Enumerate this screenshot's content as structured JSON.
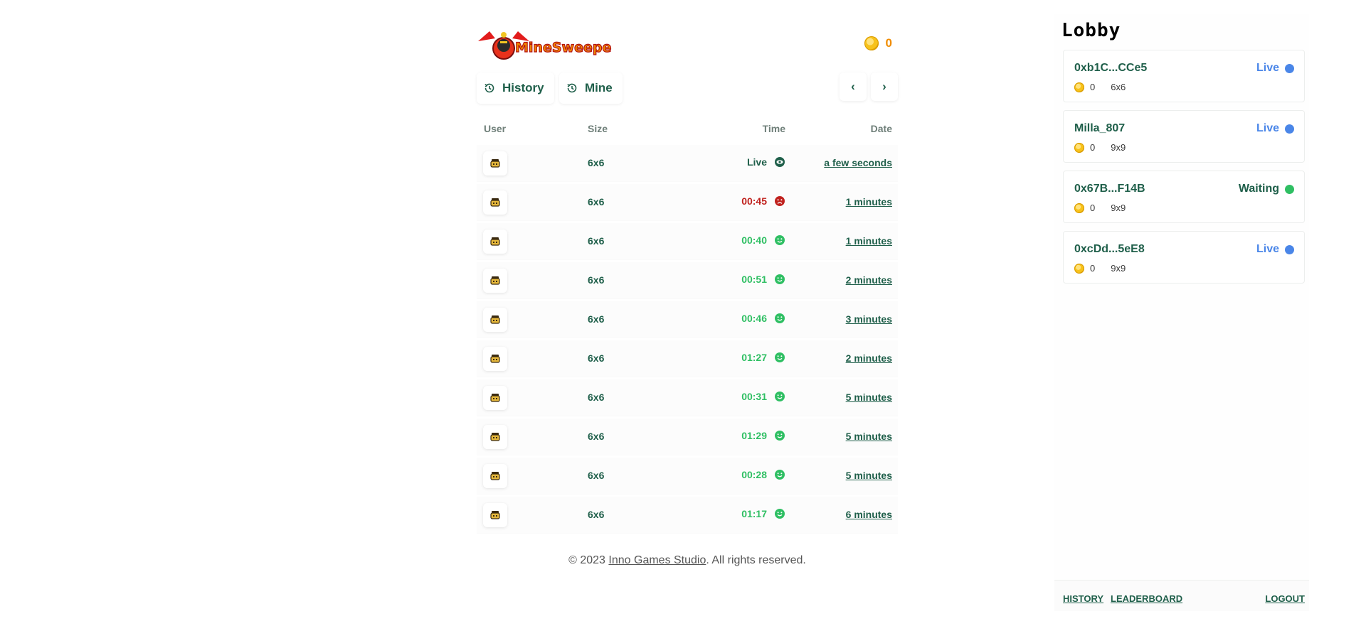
{
  "header": {
    "logo_text": "MineSweeper",
    "coin_balance": "0"
  },
  "tabs": [
    {
      "label": "History",
      "icon": "history-icon"
    },
    {
      "label": "Mine",
      "icon": "history-icon"
    }
  ],
  "pager": {
    "prev": "‹",
    "next": "›"
  },
  "table": {
    "columns": [
      "User",
      "Size",
      "Time",
      "Date"
    ],
    "rows": [
      {
        "size": "6x6",
        "time": "Live",
        "status": "live",
        "date": "a few seconds"
      },
      {
        "size": "6x6",
        "time": "00:45",
        "status": "lost",
        "date": "1 minutes"
      },
      {
        "size": "6x6",
        "time": "00:40",
        "status": "won",
        "date": "1 minutes"
      },
      {
        "size": "6x6",
        "time": "00:51",
        "status": "won",
        "date": "2 minutes"
      },
      {
        "size": "6x6",
        "time": "00:46",
        "status": "won",
        "date": "3 minutes"
      },
      {
        "size": "6x6",
        "time": "01:27",
        "status": "won",
        "date": "2 minutes"
      },
      {
        "size": "6x6",
        "time": "00:31",
        "status": "won",
        "date": "5 minutes"
      },
      {
        "size": "6x6",
        "time": "01:29",
        "status": "won",
        "date": "5 minutes"
      },
      {
        "size": "6x6",
        "time": "00:28",
        "status": "won",
        "date": "5 minutes"
      },
      {
        "size": "6x6",
        "time": "01:17",
        "status": "won",
        "date": "6 minutes"
      }
    ]
  },
  "footer": {
    "prefix": "© 2023 ",
    "link": "Inno Games Studio",
    "suffix": ". All rights reserved."
  },
  "lobby": {
    "title": "Lobby",
    "rooms": [
      {
        "name": "0xb1C...CCe5",
        "status": "Live",
        "coins": "0",
        "size": "6x6"
      },
      {
        "name": "Milla_807",
        "status": "Live",
        "coins": "0",
        "size": "9x9"
      },
      {
        "name": "0x67B...F14B",
        "status": "Waiting",
        "coins": "0",
        "size": "9x9"
      },
      {
        "name": "0xcDd...5eE8",
        "status": "Live",
        "coins": "0",
        "size": "9x9"
      }
    ],
    "footer_links": {
      "history": "HISTORY",
      "leaderboard": "LEADERBOARD",
      "logout": "LOGOUT"
    }
  },
  "colors": {
    "primary_text": "#1f5f4a",
    "won": "#2fbf63",
    "lost": "#c0221e",
    "live_status": "#4a86e8",
    "waiting_status": "#2fbf63",
    "coin": "#f7c21b",
    "coin_count": "#f08c00"
  }
}
